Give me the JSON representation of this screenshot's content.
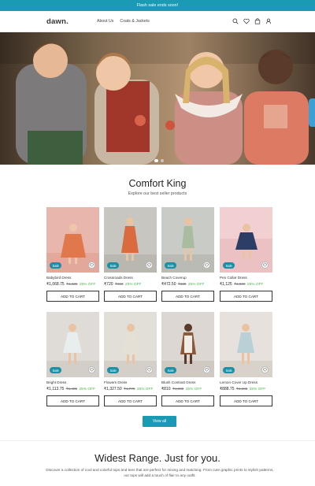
{
  "announcement": "Flash sale ends soon!",
  "header": {
    "logo": "dawn.",
    "nav": [
      "About Us",
      "Coats & Jackets"
    ],
    "icons": [
      "search-icon",
      "heart-icon",
      "bag-icon",
      "user-icon"
    ]
  },
  "hero": {
    "slide_count": 2,
    "active_slide": 1
  },
  "section": {
    "title": "Comfort King",
    "subtitle": "Explore our best seller products"
  },
  "badge_label": "Sale",
  "add_to_cart": "ADD TO CART",
  "products": [
    {
      "name": "Babybird Dress",
      "price": "₹1,068.75",
      "old": "₹1,425",
      "off": "25% OFF"
    },
    {
      "name": "Crossroads Dress",
      "price": "₹720",
      "old": "₹960",
      "off": "25% OFF"
    },
    {
      "name": "Beach Coverup",
      "price": "₹472.50",
      "old": "₹630",
      "off": "25% OFF"
    },
    {
      "name": "Pen Collar Dress",
      "price": "₹1,125",
      "old": "₹1,500",
      "off": "25% OFF"
    },
    {
      "name": "Bright Dress",
      "price": "₹1,113.75",
      "old": "₹1,485",
      "off": "25% OFF"
    },
    {
      "name": "Flowers Dress",
      "price": "₹1,327.50",
      "old": "₹1,770",
      "off": "25% OFF"
    },
    {
      "name": "Blush Contrast Dress",
      "price": "₹810",
      "old": "₹1,080",
      "off": "25% OFF"
    },
    {
      "name": "Lemon Cover Up Dress",
      "price": "₹888.75",
      "old": "₹1,185",
      "off": "25% OFF"
    }
  ],
  "view_all": "View all",
  "range": {
    "title": "Widest Range. Just for you.",
    "text": "Discover a collection of cool and colorful tops and tees that are perfect for mixing and matching. From cute graphic prints to stylish patterns, our tops will add a touch of flair to any outfit."
  },
  "colors": {
    "accent": "#1a9bb3",
    "discount": "#4ab54a"
  }
}
